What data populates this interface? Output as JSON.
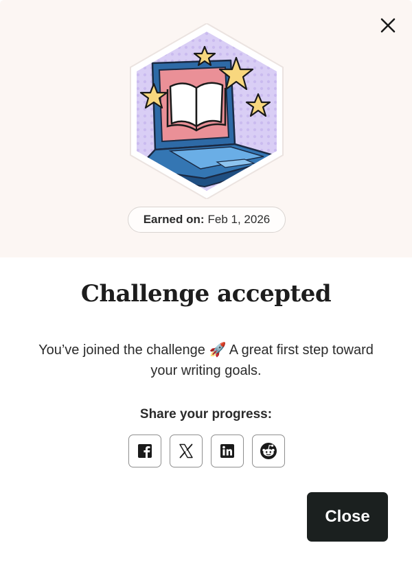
{
  "modal": {
    "earned_label": "Earned on:",
    "earned_date": "Feb 1, 2026",
    "title": "Challenge accepted",
    "description": "You’ve joined the challenge 🚀 A great first step toward your writing goals.",
    "share_label": "Share your progress:",
    "share_buttons": [
      "facebook-icon",
      "x-icon",
      "linkedin-icon",
      "reddit-icon"
    ],
    "close_label": "Close"
  },
  "colors": {
    "hero_bg": "#fcf6f3",
    "badge_bg": "#d8cdf4",
    "laptop_blue": "#2f6ca8",
    "screen_pink": "#e98f93",
    "star_yellow": "#f8d77e",
    "close_button_bg": "#1b201f"
  }
}
